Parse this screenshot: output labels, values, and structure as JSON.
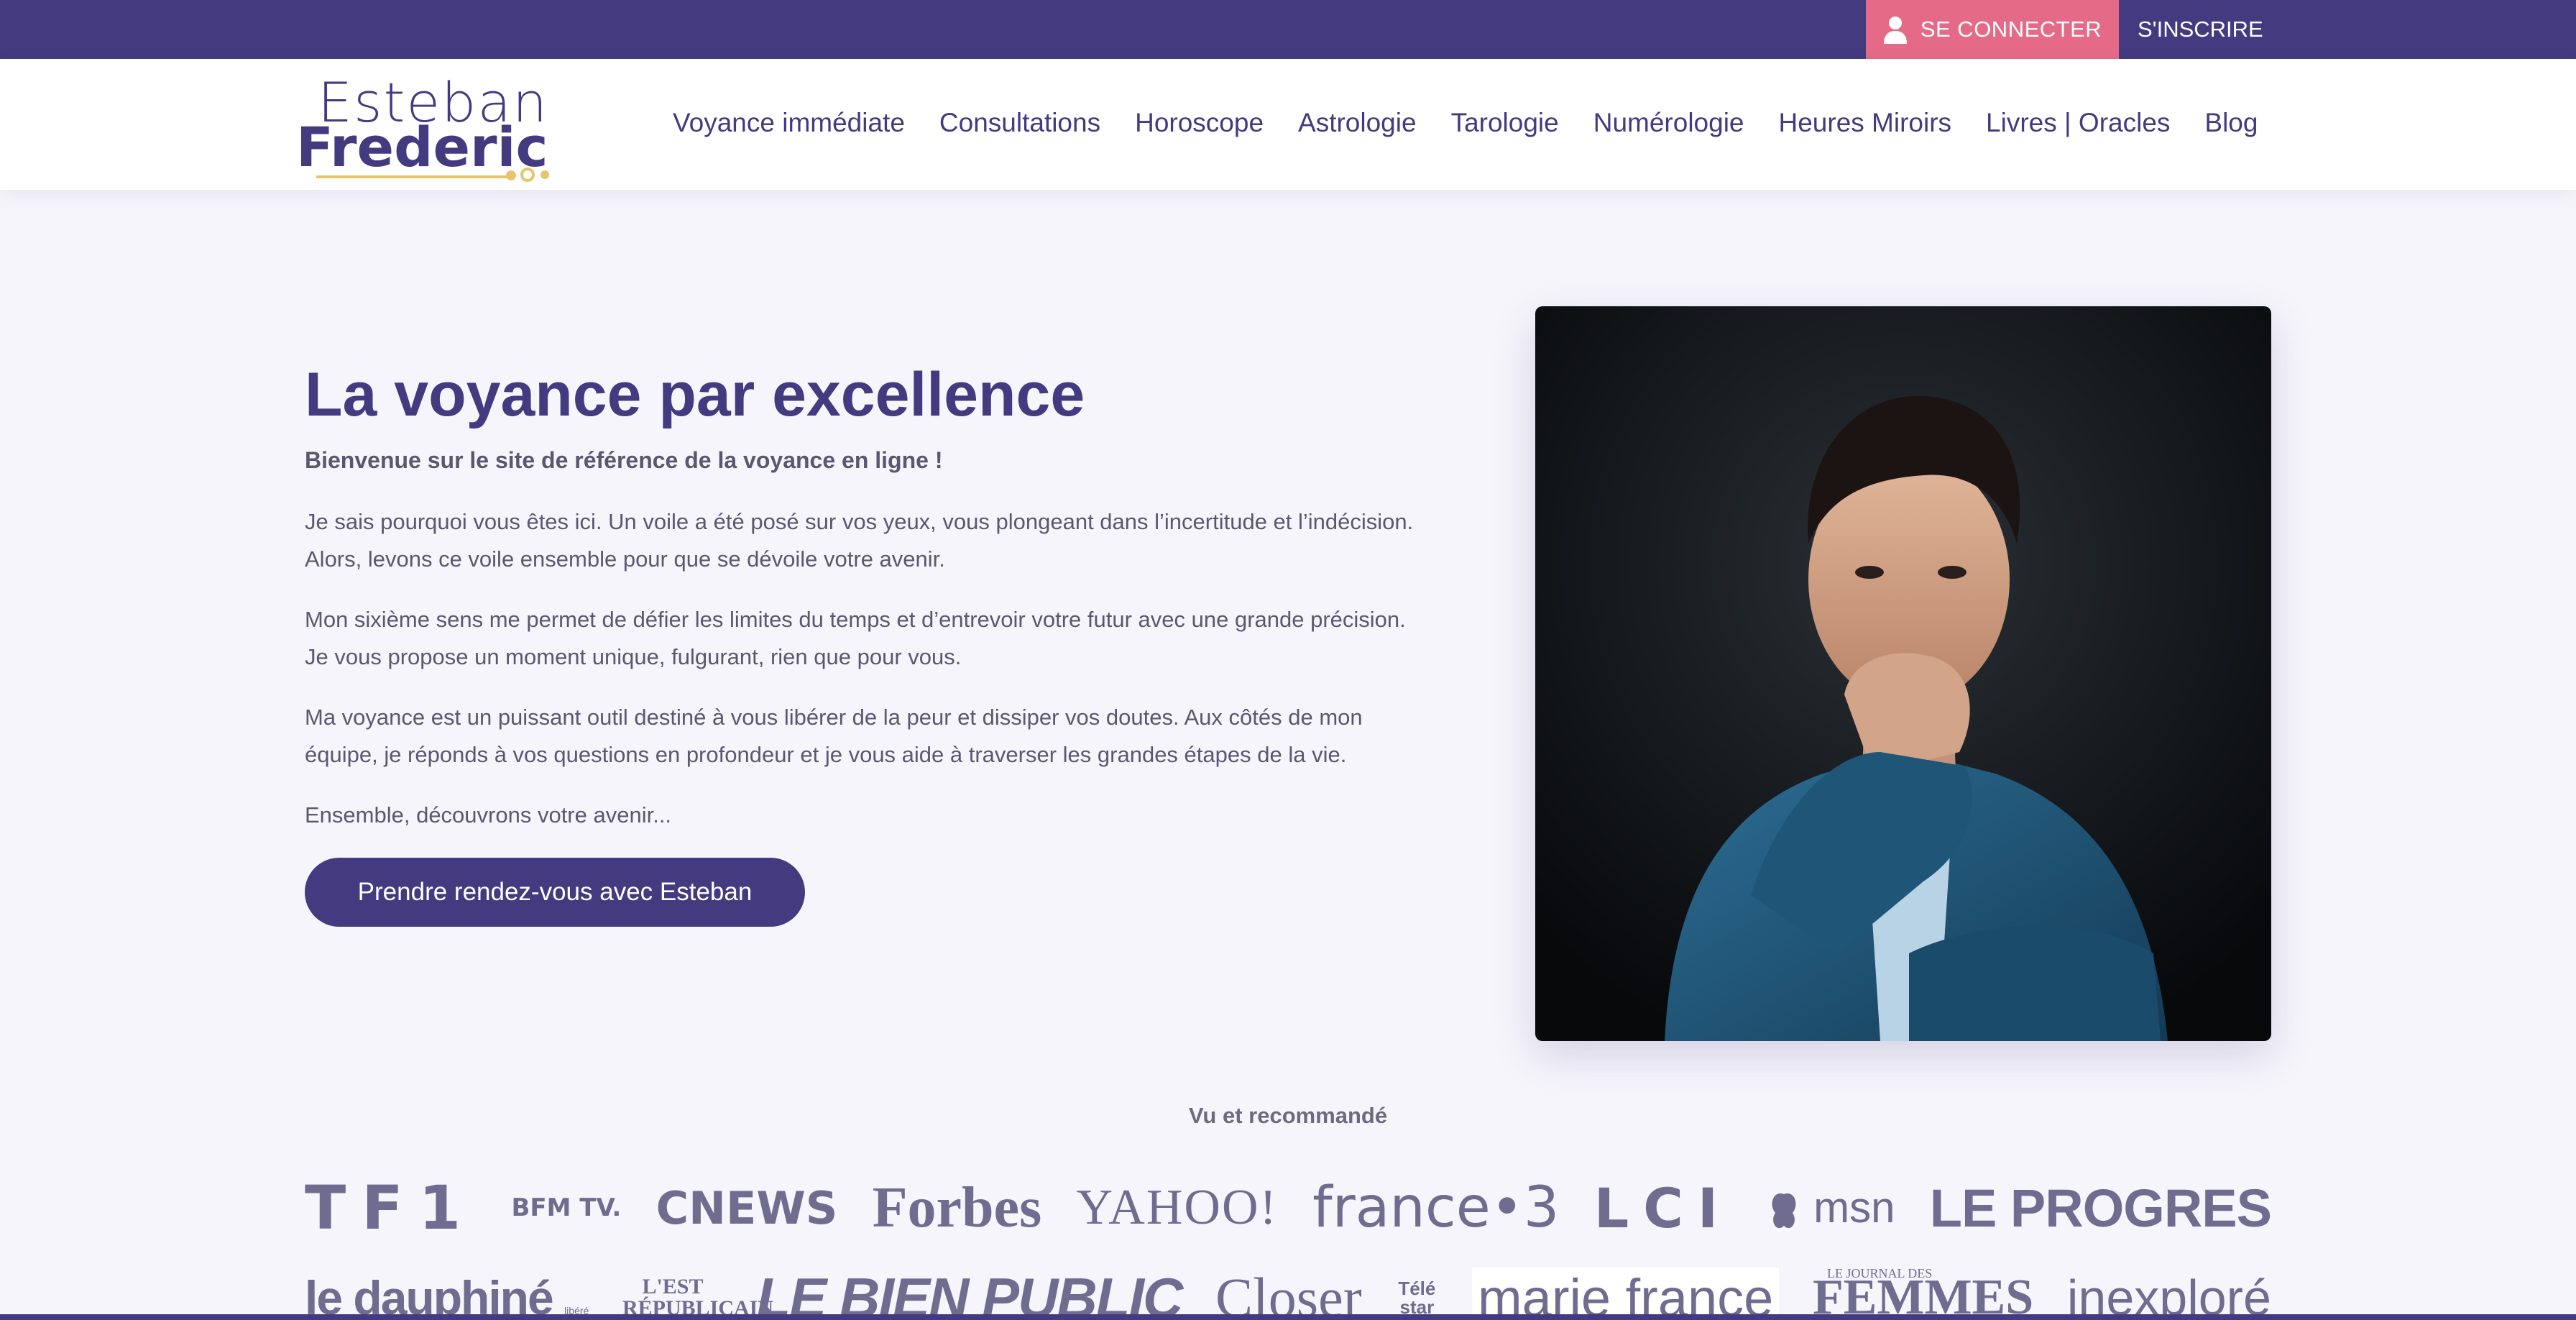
{
  "topbar": {
    "login_label": "SE CONNECTER",
    "register_label": "S'INSCRIRE",
    "login_icon": "user-icon"
  },
  "logo": {
    "line1": "Esteban",
    "line2": "Frederic"
  },
  "nav": {
    "items": [
      {
        "label": "Voyance immédiate"
      },
      {
        "label": "Consultations"
      },
      {
        "label": "Horoscope"
      },
      {
        "label": "Astrologie"
      },
      {
        "label": "Tarologie"
      },
      {
        "label": "Numérologie"
      },
      {
        "label": "Heures Miroirs"
      },
      {
        "label": "Livres | Oracles"
      },
      {
        "label": "Blog"
      }
    ]
  },
  "hero": {
    "title": "La voyance par excellence",
    "subtitle": "Bienvenue sur le site de référence de la voyance en ligne !",
    "paragraphs": [
      "Je sais pourquoi vous êtes ici. Un voile a été posé sur vos yeux, vous plongeant dans l’incertitude et l’indécision. Alors, levons ce voile ensemble pour que se dévoile votre avenir.",
      "Mon sixième sens me permet de défier les limites du temps et d’entrevoir votre futur avec une grande précision. Je vous propose un moment unique, fulgurant, rien que pour vous.",
      "Ma voyance est un puissant outil destiné à vous libérer de la peur et dissiper vos doutes. Aux côtés de mon équipe, je réponds à vos questions en profondeur et je vous aide à traverser les grandes étapes de la vie.",
      "Ensemble, découvrons votre avenir..."
    ],
    "cta_label": "Prendre rendez-vous avec Esteban"
  },
  "press": {
    "title": "Vu et recommandé",
    "row1": [
      "TF1",
      "BFM TV.",
      "CNEWS",
      "Forbes",
      "YAHOO!",
      "france•3",
      "LCI",
      "msn",
      "LE PROGRES"
    ],
    "row2": [
      "le dauphiné",
      "L'EST RÉPUBLICAIN",
      "LE BIEN PUBLIC",
      "Closer",
      "Télé star",
      "marie france",
      "FEMMES",
      "inexploré"
    ],
    "row2_extra": {
      "dauphine_suffix": "libéré",
      "femmes_prefix": "LE JOURNAL DES"
    }
  },
  "colors": {
    "brand": "#433a80",
    "accent": "#e56a87",
    "gold": "#e8c56c",
    "background": "#f6f5fb"
  }
}
